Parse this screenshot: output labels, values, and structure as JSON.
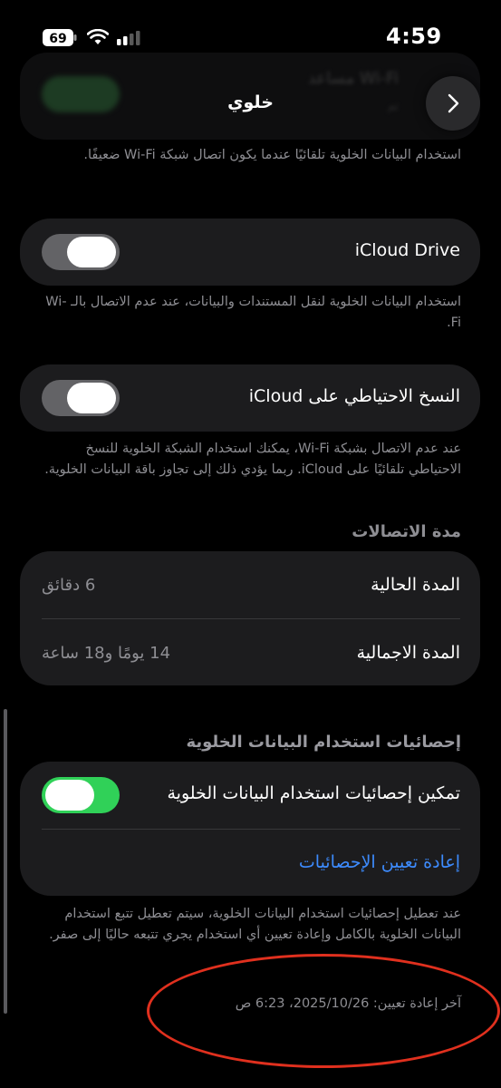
{
  "status_bar": {
    "time": "4:59",
    "battery": "69"
  },
  "header": {
    "title": "خلوي"
  },
  "top_card": {
    "ghost_title": "مساعد Wi-Fi",
    "ghost_subtitle": "تم"
  },
  "wifi_assist": {
    "description": "استخدام البيانات الخلوية تلقائيًا عندما يكون اتصال شبكة Wi-Fi ضعيفًا."
  },
  "icloud_drive": {
    "label": "iCloud Drive",
    "enabled": false,
    "description": "استخدام البيانات الخلوية لنقل المستندات والبيانات، عند عدم الاتصال بالـ Wi-Fi."
  },
  "icloud_backup": {
    "label": "النسخ الاحتياطي على iCloud",
    "enabled": false,
    "description": "عند عدم الاتصال بشبكة Wi-Fi، يمكنك استخدام الشبكة الخلوية للنسخ الاحتياطي تلقائيًا على iCloud. ربما يؤدي ذلك إلى تجاوز باقة البيانات الخلوية."
  },
  "call_time": {
    "header": "مدة الاتصالات",
    "rows": [
      {
        "label": "المدة الحالية",
        "value": "6 دقائق"
      },
      {
        "label": "المدة الاجمالية",
        "value": "14 يومًا و18 ساعة"
      }
    ]
  },
  "usage_stats": {
    "header": "إحصائيات استخدام البيانات الخلوية",
    "toggle_label": "تمكين إحصائيات استخدام البيانات الخلوية",
    "enabled": true,
    "reset_label": "إعادة تعيين الإحصائيات",
    "description": "عند تعطيل إحصائيات استخدام البيانات الخلوية، سيتم تعطيل تتبع استخدام البيانات الخلوية بالكامل وإعادة تعيين أي استخدام يجري تتبعه حاليًا إلى صفر.",
    "last_reset": "آخر إعادة تعيين: 2025/10/26، 6:23 ص"
  },
  "colors": {
    "background": "#000000",
    "card": "#1c1c1e",
    "toggle_on": "#30d158",
    "toggle_off": "#636366",
    "link": "#3d8bfd",
    "annotation": "#e0301e"
  }
}
